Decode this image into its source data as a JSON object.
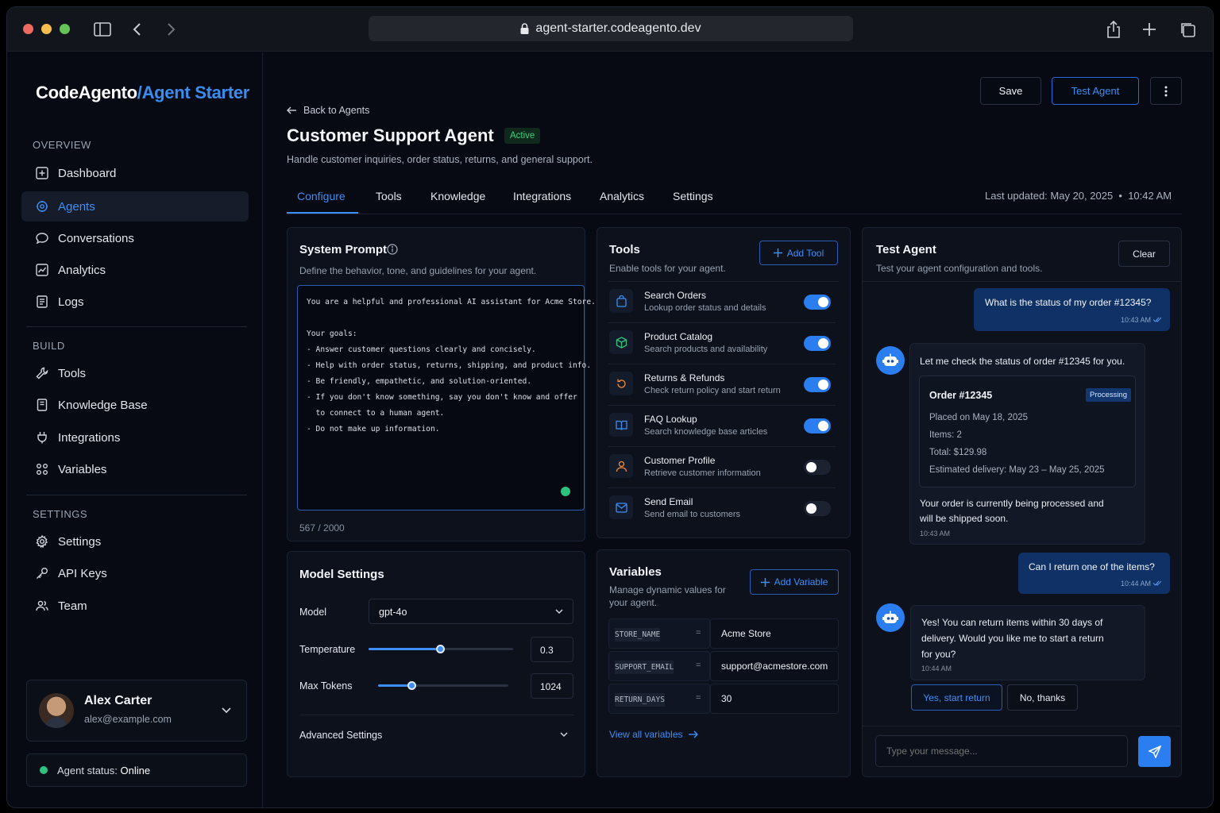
{
  "browser": {
    "url": "agent-starter.codeagento.dev"
  },
  "brand": {
    "part1": "CodeAgento",
    "part2": "/Agent Starter"
  },
  "sidebar": {
    "overview_label": "OVERVIEW",
    "overview_items": [
      {
        "label": "Dashboard",
        "icon": "dashboard-icon"
      },
      {
        "label": "Agents",
        "icon": "agents-icon",
        "active": true
      },
      {
        "label": "Conversations",
        "icon": "chat-icon"
      },
      {
        "label": "Analytics",
        "icon": "analytics-icon"
      },
      {
        "label": "Logs",
        "icon": "logs-icon"
      }
    ],
    "build_label": "BUILD",
    "build_items": [
      {
        "label": "Tools",
        "icon": "tools-icon"
      },
      {
        "label": "Knowledge Base",
        "icon": "book-icon"
      },
      {
        "label": "Integrations",
        "icon": "plug-icon"
      },
      {
        "label": "Variables",
        "icon": "variables-icon"
      }
    ],
    "settings_label": "SETTINGS",
    "settings_items": [
      {
        "label": "Settings",
        "icon": "gear-icon"
      },
      {
        "label": "API Keys",
        "icon": "key-icon"
      },
      {
        "label": "Team",
        "icon": "team-icon"
      }
    ],
    "user": {
      "name": "Alex Carter",
      "email": "alex@example.com"
    },
    "agent_status": {
      "label": "Agent status:",
      "value": "Online"
    }
  },
  "header": {
    "back_label": "Back to Agents",
    "title": "Customer Support Agent",
    "status_badge": "Active",
    "description": "Handle customer inquiries, order status, returns, and general support.",
    "save_label": "Save",
    "test_label": "Test Agent",
    "last_updated": "Last updated: May 20, 2025",
    "last_updated_time": "10:42 AM"
  },
  "tabs": [
    "Configure",
    "Tools",
    "Knowledge",
    "Integrations",
    "Analytics",
    "Settings"
  ],
  "system_prompt": {
    "title": "System Prompt",
    "subtitle": "Define the behavior, tone, and guidelines for your agent.",
    "text": "You are a helpful and professional AI assistant for Acme Store.\n\nYour goals:\n- Answer customer questions clearly and concisely.\n- Help with order status, returns, shipping, and product info.\n- Be friendly, empathetic, and solution-oriented.\n- If you don't know something, say you don't know and offer\n  to connect to a human agent.\n- Do not make up information.",
    "char_count": "567 / 2000"
  },
  "model_settings": {
    "title": "Model Settings",
    "model_label": "Model",
    "model_value": "gpt-4o",
    "temperature_label": "Temperature",
    "temperature_value": "0.3",
    "temperature_fraction": 0.5,
    "max_tokens_label": "Max Tokens",
    "max_tokens_value": "1024",
    "max_tokens_fraction": 0.26,
    "advanced_label": "Advanced Settings"
  },
  "tools": {
    "title": "Tools",
    "subtitle": "Enable tools for your agent.",
    "add_label": "Add Tool",
    "items": [
      {
        "name": "Search Orders",
        "desc": "Lookup order status and details",
        "enabled": true,
        "icon": "shopping-bag-icon",
        "color": "#3d8ef5"
      },
      {
        "name": "Product Catalog",
        "desc": "Search products and availability",
        "enabled": true,
        "icon": "box-icon",
        "color": "#2ec27e"
      },
      {
        "name": "Returns & Refunds",
        "desc": "Check return policy and start return",
        "enabled": true,
        "icon": "return-icon",
        "color": "#f08a3c"
      },
      {
        "name": "FAQ Lookup",
        "desc": "Search knowledge base articles",
        "enabled": true,
        "icon": "book-icon",
        "color": "#3d8ef5"
      },
      {
        "name": "Customer Profile",
        "desc": "Retrieve customer information",
        "enabled": false,
        "icon": "user-icon",
        "color": "#f08a3c"
      },
      {
        "name": "Send Email",
        "desc": "Send email to customers",
        "enabled": false,
        "icon": "mail-icon",
        "color": "#3d8ef5"
      }
    ]
  },
  "variables": {
    "title": "Variables",
    "subtitle_line1": "Manage dynamic values for",
    "subtitle_line2": "your agent.",
    "add_label": "Add Variable",
    "items": [
      {
        "key": "STORE_NAME",
        "value": "Acme Store"
      },
      {
        "key": "SUPPORT_EMAIL",
        "value": "support@acmestore.com"
      },
      {
        "key": "RETURN_DAYS",
        "value": "30"
      }
    ],
    "view_all": "View all variables"
  },
  "test_agent": {
    "title": "Test Agent",
    "subtitle": "Test your agent configuration and tools.",
    "clear_label": "Clear",
    "msg1": {
      "text": "What is the status of my order #12345?",
      "time": "10:43 AM"
    },
    "msg2": {
      "text": "Let me check the status of order #12345 for you."
    },
    "order": {
      "title": "Order #12345",
      "badge": "Processing",
      "placed": "Placed on May 18, 2025",
      "items": "Items: 2",
      "total": "Total: $129.98",
      "delivery": "Estimated delivery: May 23 – May 25, 2025"
    },
    "msg2_tail": {
      "line1": "Your order is currently being processed and",
      "line2": "will be shipped soon.",
      "time": "10:43 AM"
    },
    "msg3": {
      "text": "Can I return one of the items?",
      "time": "10:44 AM"
    },
    "msg4": {
      "line1": "Yes! You can return items within 30 days of",
      "line2": "delivery. Would you like me to start a return",
      "line3": "for you?",
      "time": "10:44 AM"
    },
    "quick_yes": "Yes, start return",
    "quick_no": "No, thanks",
    "input_placeholder": "Type your message..."
  }
}
